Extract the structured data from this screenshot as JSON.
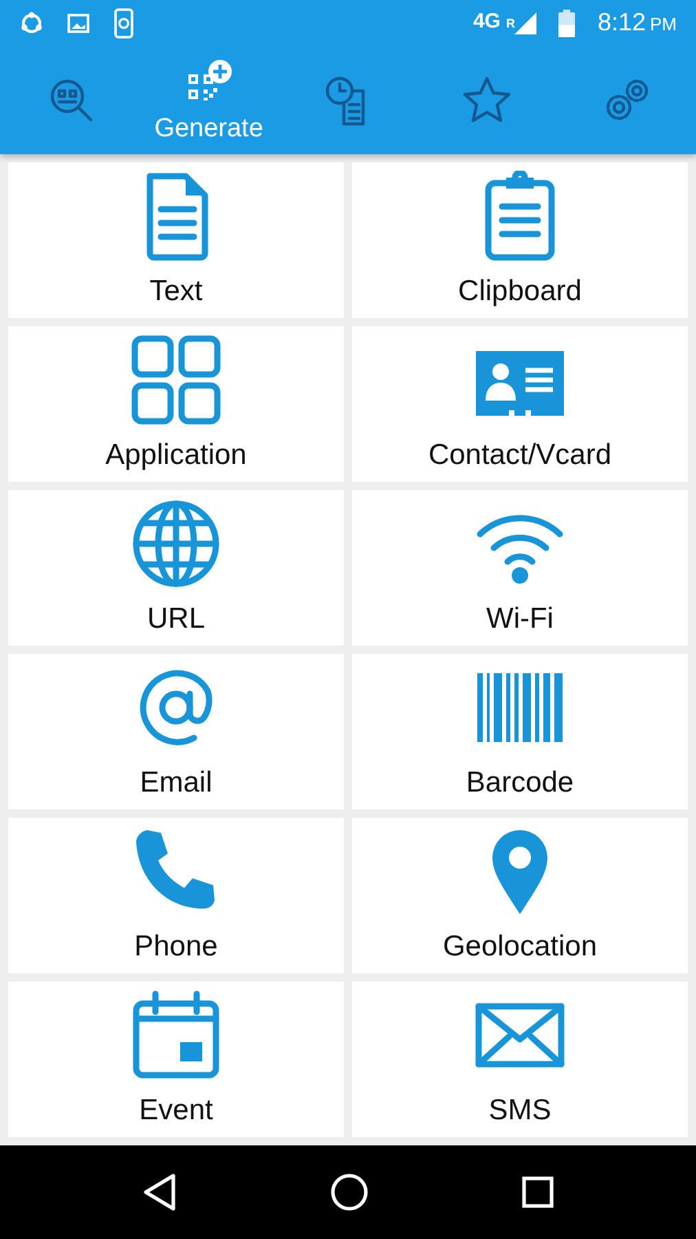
{
  "status_bar": {
    "network": "4G",
    "roaming": "R",
    "time": "8:12",
    "period": "PM"
  },
  "tabs": [
    {
      "selected": false
    },
    {
      "label": "Generate",
      "selected": true
    },
    {
      "selected": false
    },
    {
      "selected": false
    },
    {
      "selected": false
    }
  ],
  "tiles": [
    {
      "label": "Text"
    },
    {
      "label": "Clipboard"
    },
    {
      "label": "Application"
    },
    {
      "label": "Contact/Vcard"
    },
    {
      "label": "URL"
    },
    {
      "label": "Wi-Fi"
    },
    {
      "label": "Email"
    },
    {
      "label": "Barcode"
    },
    {
      "label": "Phone"
    },
    {
      "label": "Geolocation"
    },
    {
      "label": "Event"
    },
    {
      "label": "SMS"
    }
  ]
}
